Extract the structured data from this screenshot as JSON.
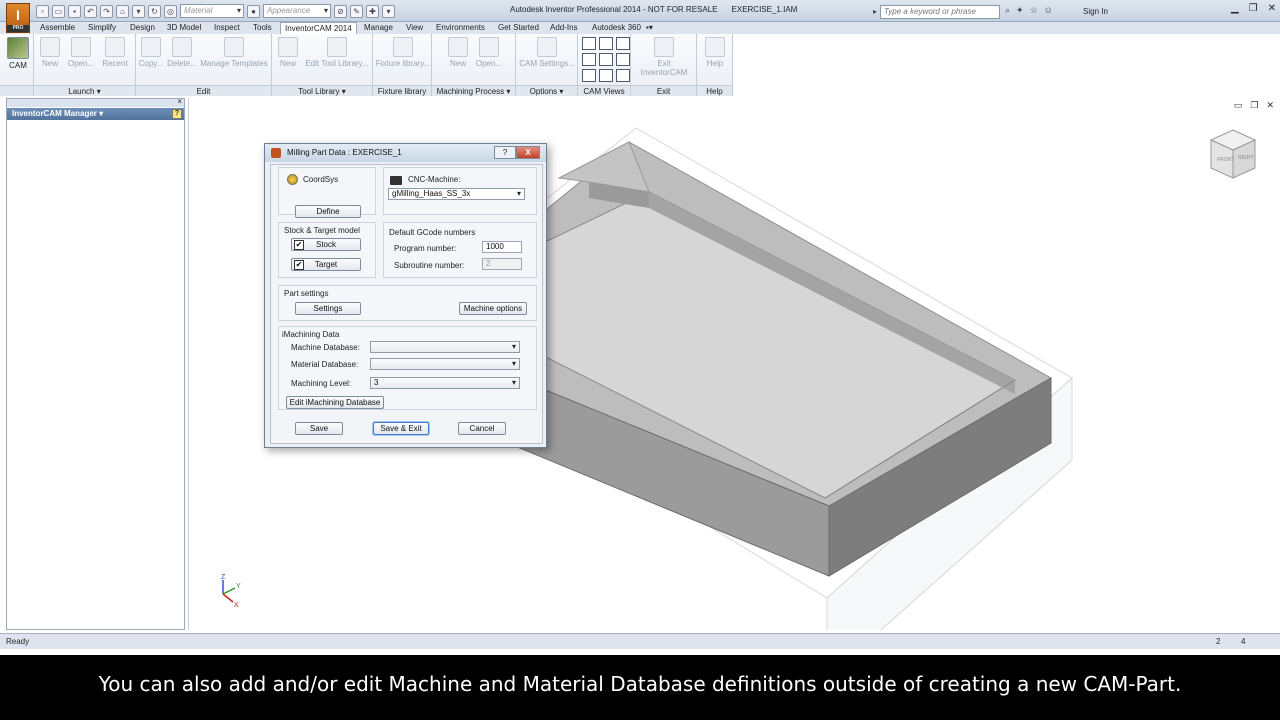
{
  "window": {
    "title": "Autodesk Inventor Professional 2014 - NOT FOR RESALE",
    "document": "EXERCISE_1.IAM",
    "search_placeholder": "Type a keyword or phrase",
    "sign_in": "Sign In",
    "material_combo": "Material",
    "appearance_combo": "Appearance",
    "logo_sub": "PRO"
  },
  "tabs": [
    "Assemble",
    "Simplify",
    "Design",
    "3D Model",
    "Inspect",
    "Tools",
    "InventorCAM 2014",
    "Manage",
    "View",
    "Environments",
    "Get Started",
    "Add-Ins",
    "Autodesk 360"
  ],
  "active_tab": "InventorCAM 2014",
  "ribbon": {
    "cam": "CAM",
    "launch": {
      "label": "Launch ▾",
      "new": "New",
      "open": "Open...",
      "recent": "Recent"
    },
    "edit": {
      "label": "Edit",
      "copy": "Copy...",
      "delete": "Delete...",
      "manage": "Manage Templates"
    },
    "tool_library": {
      "label": "Tool Library ▾",
      "new": "New",
      "edit": "Edit Tool Library..."
    },
    "fixture_library": {
      "label": "Fixture library",
      "btn": "Fixture library..."
    },
    "machining_process": {
      "label": "Machining Process ▾",
      "new": "New",
      "open": "Open..."
    },
    "options": {
      "label": "Options ▾",
      "cam_settings": "CAM Settings..."
    },
    "cam_views": {
      "label": "CAM Views"
    },
    "exit": {
      "label": "Exit",
      "btn": "Exit InventorCAM"
    },
    "help": {
      "label": "Help",
      "btn": "Help"
    }
  },
  "browser": {
    "title": "InventorCAM Manager ▾",
    "help": "?"
  },
  "dialog": {
    "title": "Milling Part Data : EXERCISE_1",
    "help_btn": "?",
    "close_btn": "X",
    "coordsys": "CoordSys",
    "define": "Define",
    "cnc_machine_label": "CNC-Machine:",
    "cnc_machine": "gMilling_Haas_SS_3x",
    "stock_target_label": "Stock & Target model",
    "stock": "Stock",
    "target": "Target",
    "gcode_label": "Default GCode numbers",
    "program_number_label": "Program number:",
    "program_number": "1000",
    "subroutine_number_label": "Subroutine number:",
    "subroutine_number": "2",
    "part_settings_label": "Part settings",
    "settings": "Settings",
    "machine_options": "Machine options",
    "imachining_label": "iMachining Data",
    "machine_db_label": "Machine Database:",
    "machine_db": "",
    "material_db_label": "Material Database:",
    "material_db": "",
    "machining_level_label": "Machining Level:",
    "machining_level": "3",
    "edit_imachining": "Edit iMachining Database",
    "save": "Save",
    "save_exit": "Save & Exit",
    "cancel": "Cancel"
  },
  "status": {
    "text": "Ready",
    "n1": "2",
    "n2": "4"
  },
  "viewcube": {
    "front": "FRONT",
    "right": "RIGHT"
  },
  "triad": {
    "x": "X",
    "y": "Y",
    "z": "Z"
  },
  "caption": "You can also add and/or edit Machine and Material Database definitions outside of creating a new CAM-Part."
}
